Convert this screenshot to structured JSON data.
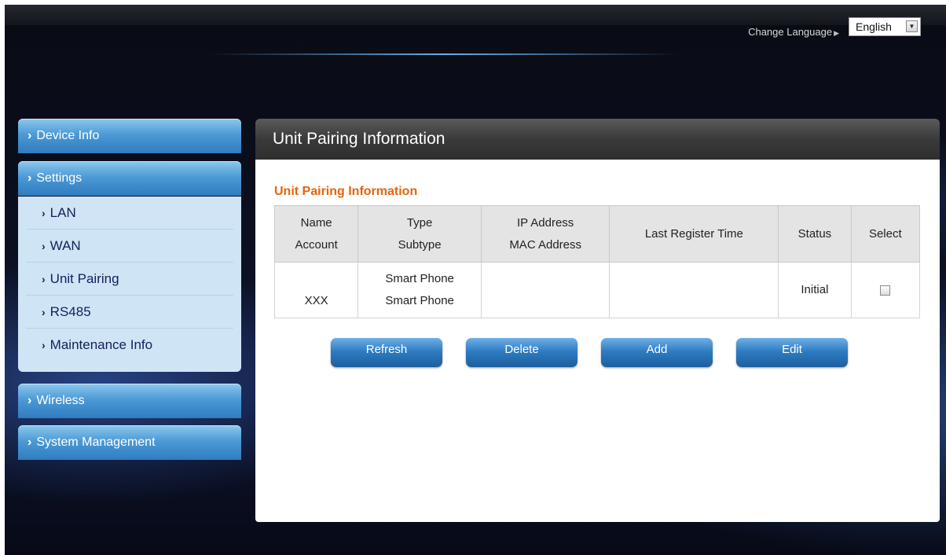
{
  "header": {
    "change_language_label": "Change Language",
    "language_selected": "English"
  },
  "sidebar": {
    "device_info": "Device Info",
    "settings": "Settings",
    "settings_items": [
      "LAN",
      "WAN",
      "Unit Pairing",
      "RS485",
      "Maintenance Info"
    ],
    "wireless": "Wireless",
    "system_management": "System Management"
  },
  "panel": {
    "title": "Unit Pairing Information",
    "subtitle": "Unit Pairing Information"
  },
  "table": {
    "headers": {
      "name": "Name",
      "account": "Account",
      "type": "Type",
      "subtype": "Subtype",
      "ip_address": "IP Address",
      "mac_address": "MAC Address",
      "last_register_time": "Last Register Time",
      "status": "Status",
      "select": "Select"
    },
    "rows": [
      {
        "name": "",
        "account": "XXX",
        "type": "Smart Phone",
        "subtype": "Smart Phone",
        "ip_address": "",
        "mac_address": "",
        "last_register_time": "",
        "status": "Initial",
        "selected": false
      }
    ]
  },
  "buttons": {
    "refresh": "Refresh",
    "delete": "Delete",
    "add": "Add",
    "edit": "Edit"
  },
  "colors": {
    "accent_orange": "#e8630a",
    "sidebar_blue": "#3a86c8",
    "panel_header": "#3a3a3a"
  }
}
